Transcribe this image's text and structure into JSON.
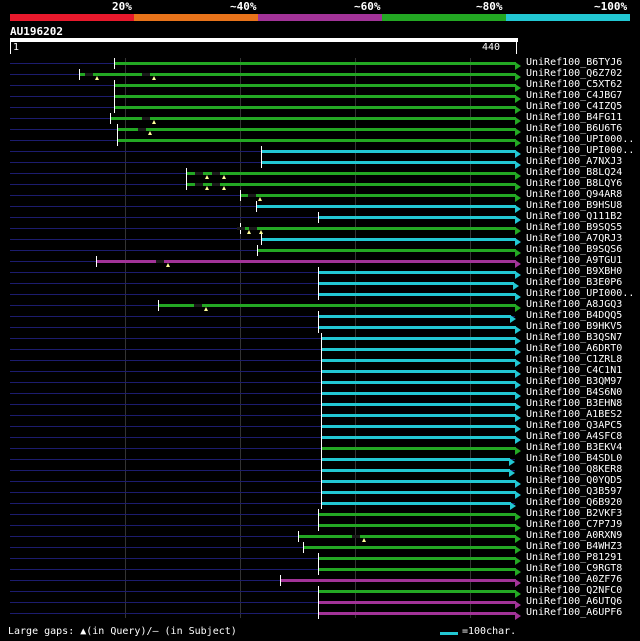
{
  "header": {
    "identity_labels": [
      "20%",
      "~40%",
      "~60%",
      "~80%",
      "~100%"
    ],
    "bands": [
      "#e8192c",
      "#e8731a",
      "#a23398",
      "#23a823",
      "#22c7d3"
    ]
  },
  "query": {
    "id": "AU196202",
    "start": "1",
    "end": "440",
    "length": 440
  },
  "colors": {
    "blue": "#22c7d3",
    "green": "#23a823",
    "purple": "#a23398"
  },
  "hits": [
    {
      "label": "UniRef100_B6TYJ6",
      "color": "green",
      "start": 90,
      "end": 440,
      "marks": []
    },
    {
      "label": "UniRef100_Q6Z702",
      "color": "green",
      "start": 60,
      "end": 440,
      "marks": [
        76,
        125
      ]
    },
    {
      "label": "UniRef100_C5XT62",
      "color": "green",
      "start": 90,
      "end": 440,
      "marks": []
    },
    {
      "label": "UniRef100_C4JBG7",
      "color": "green",
      "start": 90,
      "end": 440,
      "marks": []
    },
    {
      "label": "UniRef100_C4IZQ5",
      "color": "green",
      "start": 90,
      "end": 440,
      "marks": []
    },
    {
      "label": "UniRef100_B4FG11",
      "color": "green",
      "start": 87,
      "end": 440,
      "marks": [
        125
      ]
    },
    {
      "label": "UniRef100_B6U6T6",
      "color": "green",
      "start": 93,
      "end": 440,
      "marks": [
        122
      ]
    },
    {
      "label": "UniRef100_UPI000..",
      "color": "green",
      "start": 93,
      "end": 440,
      "marks": []
    },
    {
      "label": "UniRef100_UPI000..",
      "color": "blue",
      "start": 218,
      "end": 440,
      "marks": []
    },
    {
      "label": "UniRef100_A7NXJ3",
      "color": "blue",
      "start": 218,
      "end": 440,
      "marks": []
    },
    {
      "label": "UniRef100_B8LQ24",
      "color": "green",
      "start": 153,
      "end": 440,
      "marks": [
        171,
        186
      ]
    },
    {
      "label": "UniRef100_B8LQY6",
      "color": "green",
      "start": 153,
      "end": 440,
      "marks": [
        171,
        186
      ]
    },
    {
      "label": "UniRef100_Q94AR8",
      "color": "green",
      "start": 200,
      "end": 440,
      "marks": [
        217
      ]
    },
    {
      "label": "UniRef100_B9HSU8",
      "color": "blue",
      "start": 214,
      "end": 440,
      "marks": []
    },
    {
      "label": "UniRef100_Q111B2",
      "color": "blue",
      "start": 268,
      "end": 440,
      "marks": []
    },
    {
      "label": "UniRef100_B9SQS5",
      "color": "green",
      "start": 200,
      "end": 440,
      "marks": [
        208,
        218
      ]
    },
    {
      "label": "UniRef100_A7QRJ3",
      "color": "blue",
      "start": 218,
      "end": 440,
      "marks": []
    },
    {
      "label": "UniRef100_B9SQS6",
      "color": "green",
      "start": 215,
      "end": 440,
      "marks": []
    },
    {
      "label": "UniRef100_A9TGU1",
      "color": "purple",
      "start": 75,
      "end": 440,
      "marks": [
        137
      ]
    },
    {
      "label": "UniRef100_B9XBH0",
      "color": "blue",
      "start": 268,
      "end": 440,
      "marks": []
    },
    {
      "label": "UniRef100_B3E0P6",
      "color": "blue",
      "start": 268,
      "end": 438,
      "marks": []
    },
    {
      "label": "UniRef100_UPI000..",
      "color": "blue",
      "start": 268,
      "end": 440,
      "marks": []
    },
    {
      "label": "UniRef100_A8JGQ3",
      "color": "green",
      "start": 129,
      "end": 440,
      "marks": [
        170
      ]
    },
    {
      "label": "UniRef100_B4DQQ5",
      "color": "blue",
      "start": 268,
      "end": 436,
      "marks": []
    },
    {
      "label": "UniRef100_B9HKV5",
      "color": "blue",
      "start": 268,
      "end": 440,
      "marks": []
    },
    {
      "label": "UniRef100_B3QSN7",
      "color": "blue",
      "start": 270,
      "end": 440,
      "marks": []
    },
    {
      "label": "UniRef100_A6DRT0",
      "color": "blue",
      "start": 270,
      "end": 440,
      "marks": []
    },
    {
      "label": "UniRef100_C1ZRL8",
      "color": "blue",
      "start": 270,
      "end": 440,
      "marks": []
    },
    {
      "label": "UniRef100_C4C1N1",
      "color": "blue",
      "start": 270,
      "end": 440,
      "marks": []
    },
    {
      "label": "UniRef100_B3QM97",
      "color": "blue",
      "start": 270,
      "end": 440,
      "marks": []
    },
    {
      "label": "UniRef100_B4S6N0",
      "color": "blue",
      "start": 270,
      "end": 440,
      "marks": []
    },
    {
      "label": "UniRef100_B3EHN8",
      "color": "blue",
      "start": 270,
      "end": 440,
      "marks": []
    },
    {
      "label": "UniRef100_A1BES2",
      "color": "blue",
      "start": 270,
      "end": 440,
      "marks": []
    },
    {
      "label": "UniRef100_Q3APC5",
      "color": "blue",
      "start": 270,
      "end": 440,
      "marks": []
    },
    {
      "label": "UniRef100_A4SFC8",
      "color": "blue",
      "start": 270,
      "end": 440,
      "marks": []
    },
    {
      "label": "UniRef100_B3EKV4",
      "color": "green",
      "start": 270,
      "end": 440,
      "marks": []
    },
    {
      "label": "UniRef100_B4SDL0",
      "color": "blue",
      "start": 270,
      "end": 435,
      "marks": []
    },
    {
      "label": "UniRef100_Q8KER8",
      "color": "blue",
      "start": 270,
      "end": 435,
      "marks": []
    },
    {
      "label": "UniRef100_Q0YQD5",
      "color": "blue",
      "start": 270,
      "end": 440,
      "marks": []
    },
    {
      "label": "UniRef100_Q3B597",
      "color": "blue",
      "start": 270,
      "end": 440,
      "marks": []
    },
    {
      "label": "UniRef100_Q6B920",
      "color": "blue",
      "start": 270,
      "end": 436,
      "marks": []
    },
    {
      "label": "UniRef100_B2VKF3",
      "color": "green",
      "start": 268,
      "end": 440,
      "marks": []
    },
    {
      "label": "UniRef100_C7P7J9",
      "color": "green",
      "start": 268,
      "end": 440,
      "marks": []
    },
    {
      "label": "UniRef100_A0RXN9",
      "color": "green",
      "start": 250,
      "end": 440,
      "marks": [
        308
      ]
    },
    {
      "label": "UniRef100_B4WHZ3",
      "color": "green",
      "start": 255,
      "end": 440,
      "marks": []
    },
    {
      "label": "UniRef100_P81291",
      "color": "green",
      "start": 268,
      "end": 440,
      "marks": []
    },
    {
      "label": "UniRef100_C9RGT8",
      "color": "green",
      "start": 268,
      "end": 440,
      "marks": []
    },
    {
      "label": "UniRef100_A0ZF76",
      "color": "purple",
      "start": 235,
      "end": 440,
      "marks": []
    },
    {
      "label": "UniRef100_Q2NFC0",
      "color": "green",
      "start": 268,
      "end": 440,
      "marks": []
    },
    {
      "label": "UniRef100_A6UTQ6",
      "color": "purple",
      "start": 268,
      "end": 440,
      "marks": []
    },
    {
      "label": "UniRef100_A6UPF6",
      "color": "purple",
      "start": 268,
      "end": 440,
      "marks": []
    }
  ],
  "footer": {
    "legend_text": "Large gaps: ▲(in Query)/— (in Subject)",
    "scale_text": "=100char."
  }
}
